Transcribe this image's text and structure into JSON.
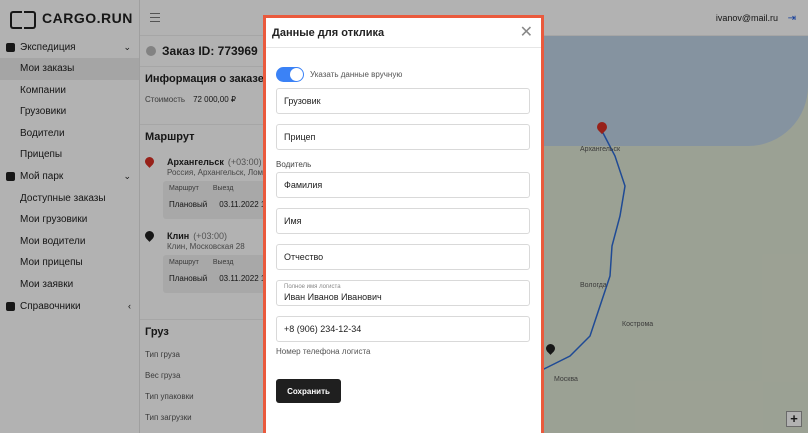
{
  "app": {
    "logo": "CARGO.RUN",
    "user_email": "ivanov@mail.ru"
  },
  "sidebar": {
    "groups": [
      {
        "label": "Экспедиция",
        "items": [
          "Мои заказы",
          "Компании",
          "Грузовики",
          "Водители",
          "Прицепы"
        ]
      },
      {
        "label": "Мой парк",
        "items": [
          "Доступные заказы",
          "Мои грузовики",
          "Мои водители",
          "Мои прицепы",
          "Мои заявки"
        ]
      },
      {
        "label": "Справочники",
        "items": []
      }
    ]
  },
  "order": {
    "title": "Заказ ID: 773969",
    "info_title": "Информация о заказе",
    "cost_label": "Стоимость",
    "cost_value": "72 000,00 ₽",
    "route_title": "Маршрут",
    "points": [
      {
        "name": "Архангельск",
        "tz": "(+03:00)",
        "address": "Россия, Архангельск, Ломоно",
        "col1": "Маршрут",
        "col2": "Выезд",
        "row_type": "Плановый",
        "row_date": "03.11.2022 13:50"
      },
      {
        "name": "Клин",
        "tz": "(+03:00)",
        "address": "Клин, Московская 28",
        "col1": "Маршрут",
        "col2": "Выезд",
        "row_type": "Плановый",
        "row_date": "03.11.2022 13:50"
      }
    ],
    "cargo_title": "Груз",
    "cargo_rows": [
      "Тип груза",
      "Вес груза",
      "Тип упаковки",
      "Тип загрузки"
    ]
  },
  "map": {
    "cities": [
      "Архангельск",
      "Вологда",
      "Кострома",
      "Москва"
    ],
    "zoom_in": "+"
  },
  "modal": {
    "title": "Данные для отклика",
    "toggle_label": "Указать данные вручную",
    "toggle_on": true,
    "truck_placeholder": "Грузовик",
    "trailer_placeholder": "Прицеп",
    "driver_section": "Водитель",
    "last_name_placeholder": "Фамилия",
    "first_name_placeholder": "Имя",
    "patronymic_placeholder": "Отчество",
    "logist_name_label": "Полное имя логиста",
    "logist_name_value": "Иван Иванов Иванович",
    "phone_value": "+8 (906) 234-12-34",
    "phone_hint": "Номер телефона логиста",
    "save_label": "Сохранить"
  },
  "colors": {
    "modal_border": "#ea5a3d",
    "toggle_on": "#3b82f6",
    "save_button": "#1f1f1f",
    "pin_start": "#d93025",
    "route_line": "#2d6bd6"
  }
}
